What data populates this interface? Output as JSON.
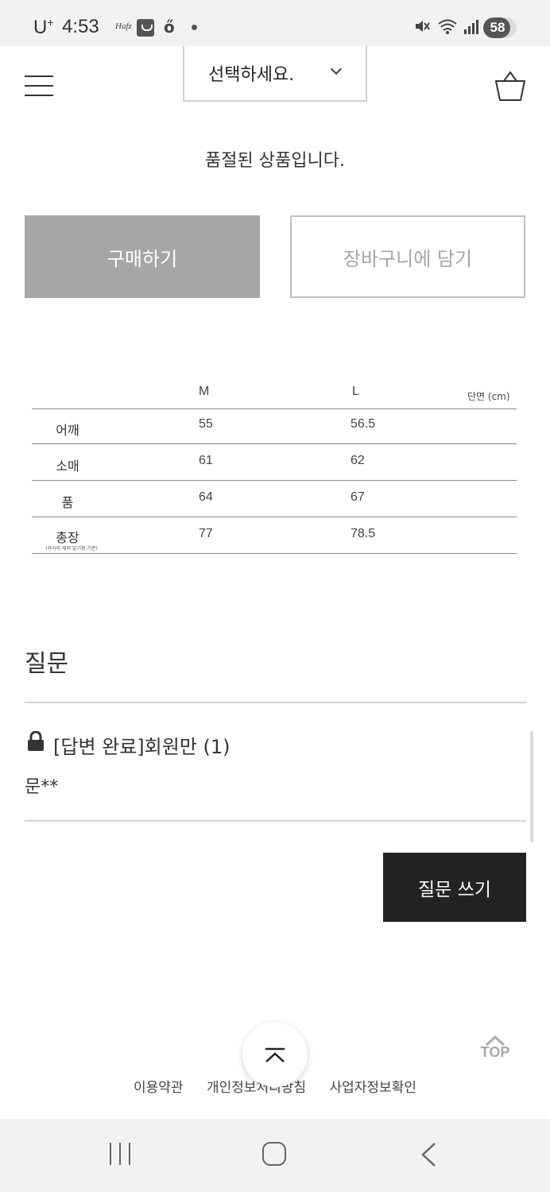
{
  "status_bar": {
    "carrier": "U",
    "carrier_sup": "+",
    "time": "4:53",
    "app_icon_1": "Hafz",
    "app_icon_3": "ő",
    "battery": "58",
    "icons": [
      "shopping-bag-icon",
      "mute-icon",
      "wifi-icon",
      "signal-icon",
      "battery-icon"
    ]
  },
  "header": {
    "menu_icon": "hamburger-icon",
    "option_select": {
      "selected": "선택하세요."
    },
    "cart_icon": "shopping-basket-icon"
  },
  "product": {
    "soldout_text": "품절된 상품입니다.",
    "buy_label": "구매하기",
    "add_to_cart_label": "장바구니에 담기"
  },
  "size_table": {
    "unit": "단면 (cm)",
    "columns": [
      "M",
      "L"
    ],
    "rows": [
      {
        "label": "어깨",
        "values": [
          "55",
          "56.5"
        ]
      },
      {
        "label": "소매",
        "values": [
          "61",
          "62"
        ]
      },
      {
        "label": "품",
        "values": [
          "64",
          "67"
        ]
      },
      {
        "label": "총장",
        "sublabel": "(카라와 제외 밑기장 기준)",
        "values": [
          "77",
          "78.5"
        ]
      }
    ]
  },
  "qa": {
    "title": "질문",
    "items": [
      {
        "title": "[답변 완료]회원만 (1)",
        "author": "문**"
      }
    ],
    "write_label": "질문 쓰기"
  },
  "footer": {
    "links": [
      "이용약관",
      "개인정보처리방침",
      "사업자정보확인"
    ],
    "top_label": "TOP"
  },
  "colors": {
    "buy_button_bg": "#a6a6a6",
    "ask_button_bg": "#232323",
    "status_bar_bg": "#f2f2f2"
  }
}
